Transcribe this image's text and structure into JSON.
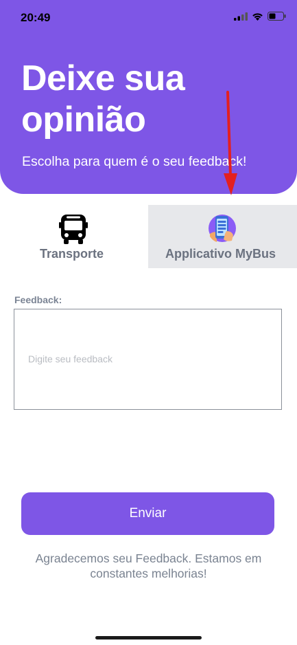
{
  "status_bar": {
    "time": "20:49"
  },
  "header": {
    "title_line1": "Deixe sua",
    "title_line2": "opinião",
    "subtitle": "Escolha para quem é o seu feedback!"
  },
  "tabs": [
    {
      "label": "Transporte",
      "icon": "bus-icon",
      "selected": true
    },
    {
      "label": "Applicativo MyBus",
      "icon": "phone-app-icon",
      "selected": false
    }
  ],
  "form": {
    "feedback_label": "Feedback:",
    "feedback_placeholder": "Digite seu feedback",
    "feedback_value": "",
    "submit_label": "Enviar"
  },
  "footer": {
    "thanks_line1": "Agradecemos seu Feedback. Estamos em",
    "thanks_line2": "constantes melhorias!"
  },
  "colors": {
    "primary": "#7e56e6",
    "tab_inactive_bg": "#e7e8eb",
    "annotation_arrow": "#e32020"
  }
}
